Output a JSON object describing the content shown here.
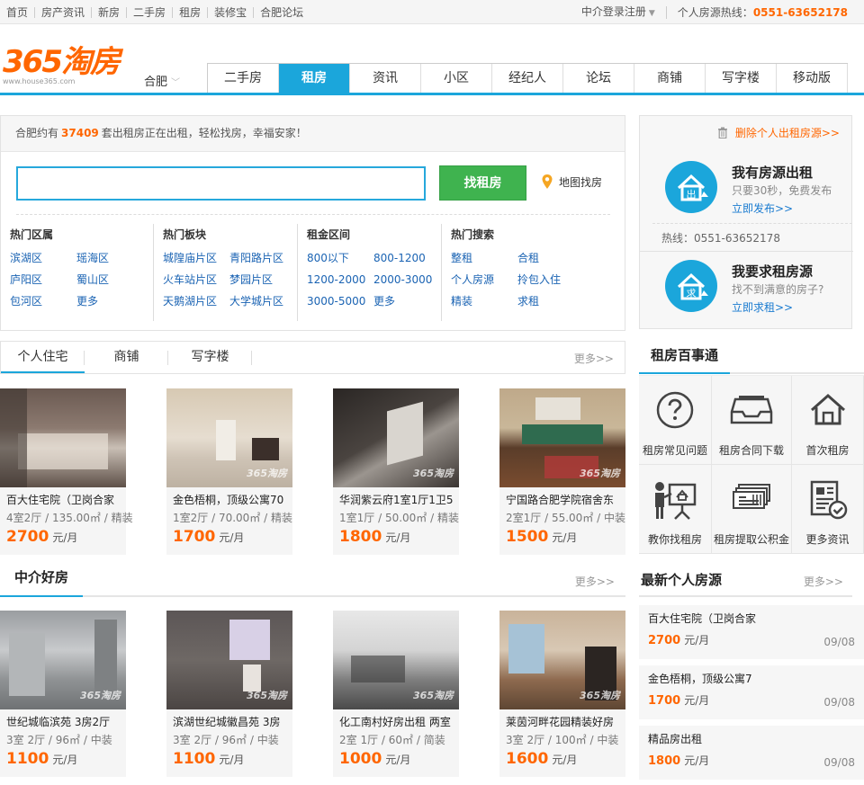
{
  "topbar": {
    "nav": [
      "首页",
      "房产资讯",
      "新房",
      "二手房",
      "租房",
      "装修宝",
      "合肥论坛"
    ],
    "login": "中介登录注册",
    "hotline_label": "个人房源热线：",
    "hotline_number": "0551-63652178"
  },
  "header": {
    "logo_text": "365淘房",
    "logo_url": "www.house365.com",
    "city": "合肥",
    "nav": [
      "二手房",
      "租房",
      "资讯",
      "小区",
      "经纪人",
      "论坛",
      "商铺",
      "写字楼",
      "移动版"
    ],
    "active_nav": "租房"
  },
  "search": {
    "notice_prefix": "合肥约有",
    "count": "37409",
    "notice_suffix": "套出租房正在出租，轻松找房，幸福安家！",
    "placeholder": "",
    "button": "找租房",
    "map_link": "地图找房",
    "filters": [
      {
        "title": "热门区属",
        "items": [
          "滨湖区",
          "瑶海区",
          "庐阳区",
          "蜀山区",
          "包河区",
          "更多"
        ]
      },
      {
        "title": "热门板块",
        "items": [
          "城隍庙片区",
          "青阳路片区",
          "火车站片区",
          "梦园片区",
          "天鹅湖片区",
          "大学城片区"
        ]
      },
      {
        "title": "租金区间",
        "items": [
          "800以下",
          "800-1200",
          "1200-2000",
          "2000-3000",
          "3000-5000",
          "更多"
        ]
      },
      {
        "title": "热门搜索",
        "items": [
          "整租",
          "合租",
          "个人房源",
          "拎包入住",
          "精装",
          "求租"
        ]
      }
    ]
  },
  "right_panel": {
    "delete_link": "删除个人出租房源>>",
    "offer": {
      "title": "我有房源出租",
      "sub": "只要30秒，免费发布",
      "link": "立即发布>>",
      "icon_char": "出"
    },
    "hotline": "热线：0551-63652178",
    "want": {
      "title": "我要求租房源",
      "sub": "找不到满意的房子?",
      "link": "立即求租>>",
      "icon_char": "求"
    }
  },
  "tabs": {
    "items": [
      "个人住宅",
      "商铺",
      "写字楼"
    ],
    "more": "更多>>"
  },
  "personal_listings": [
    {
      "title": "百大住宅院（卫岗合家",
      "spec": "4室2厅 / 135.00㎡ / 精装",
      "price": "2700",
      "unit": "元/月"
    },
    {
      "title": "金色梧桐，顶级公寓70",
      "spec": "1室2厅 / 70.00㎡ / 精装",
      "price": "1700",
      "unit": "元/月"
    },
    {
      "title": "华润紫云府1室1厅1卫5",
      "spec": "1室1厅 / 50.00㎡ / 精装",
      "price": "1800",
      "unit": "元/月"
    },
    {
      "title": "宁国路合肥学院宿舍东",
      "spec": "2室1厅 / 55.00㎡ / 中装",
      "price": "1500",
      "unit": "元/月"
    }
  ],
  "agent_section": {
    "title": "中介好房",
    "more": "更多>>"
  },
  "agent_listings": [
    {
      "title": "世纪城临滨苑 3房2厅",
      "spec": "3室 2厅 / 96㎡ / 中装",
      "price": "1100",
      "unit": "元/月"
    },
    {
      "title": "滨湖世纪城徽昌苑 3房",
      "spec": "3室 2厅 / 96㎡ / 中装",
      "price": "1100",
      "unit": "元/月"
    },
    {
      "title": "化工南村好房出租 两室",
      "spec": "2室 1厅 / 60㎡ / 简装",
      "price": "1000",
      "unit": "元/月"
    },
    {
      "title": "莱茵河畔花园精装好房",
      "spec": "3室 2厅 / 100㎡ / 中装",
      "price": "1600",
      "unit": "元/月"
    }
  ],
  "watermark": "365淘房",
  "services": {
    "title": "租房百事通",
    "items": [
      {
        "label": "租房常见问题",
        "icon": "question-icon"
      },
      {
        "label": "租房合同下载",
        "icon": "inbox-download-icon"
      },
      {
        "label": "首次租房",
        "icon": "house-icon"
      },
      {
        "label": "教你找租房",
        "icon": "teacher-board-icon"
      },
      {
        "label": "租房提取公积金",
        "icon": "money-stack-icon"
      },
      {
        "label": "更多资讯",
        "icon": "document-check-icon"
      }
    ]
  },
  "latest": {
    "title": "最新个人房源",
    "more": "更多>>",
    "items": [
      {
        "title": "百大住宅院（卫岗合家",
        "price": "2700",
        "unit": "元/月",
        "date": "09/08"
      },
      {
        "title": "金色梧桐，顶级公寓7",
        "price": "1700",
        "unit": "元/月",
        "date": "09/08"
      },
      {
        "title": "精品房出租",
        "price": "1800",
        "unit": "元/月",
        "date": "09/08"
      }
    ]
  },
  "colors": {
    "accent": "#1ba6db",
    "price": "#ff6600",
    "button": "#3fb34f",
    "link": "#1a63b3"
  }
}
